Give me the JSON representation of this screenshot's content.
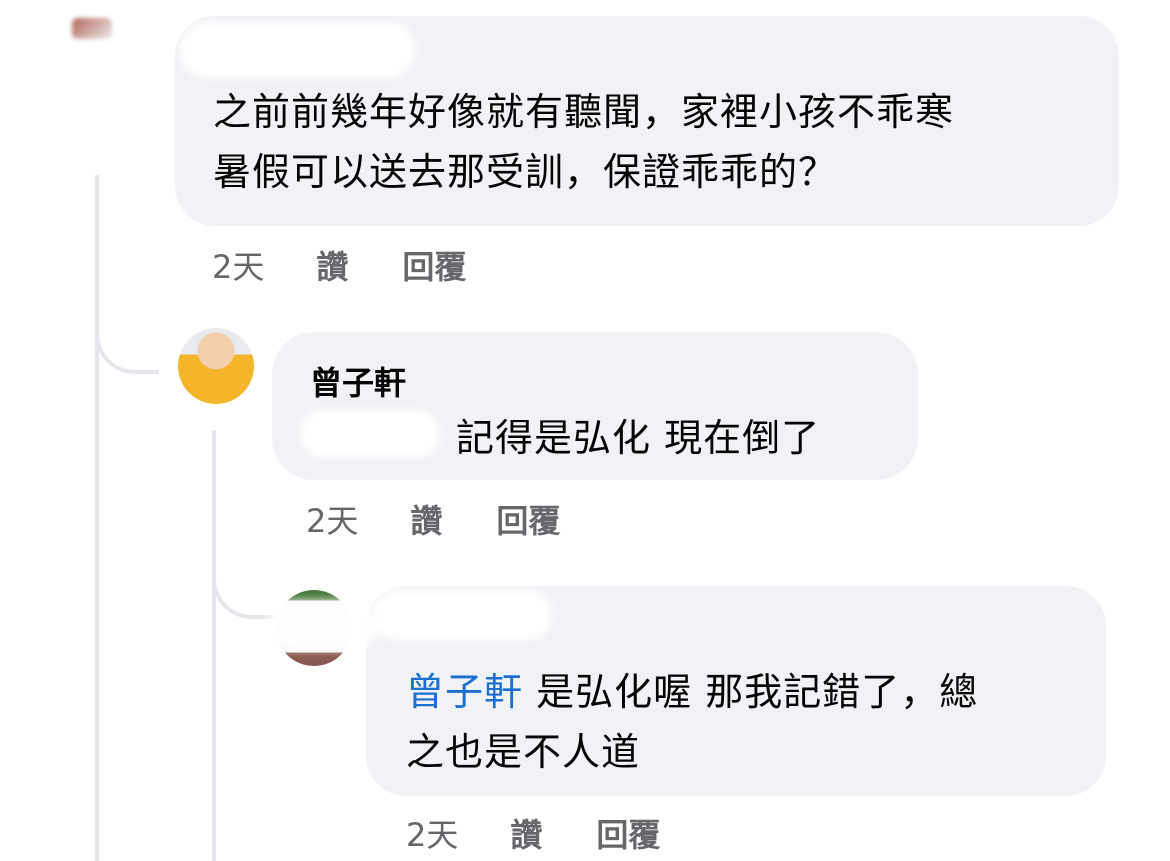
{
  "comments": [
    {
      "text": "之前前幾年好像就有聽聞，家裡小孩不乖寒暑假可以送去那受訓，保證乖乖的？",
      "line1": "之前前幾年好像就有聽聞，家裡小孩不乖寒",
      "line2": "暑假可以送去那受訓，保證乖乖的？",
      "time": "2天",
      "like_label": "讚",
      "reply_label": "回覆"
    },
    {
      "author": "曾子軒",
      "text": "記得是弘化 現在倒了",
      "time": "2天",
      "like_label": "讚",
      "reply_label": "回覆"
    },
    {
      "mention": "曾子軒",
      "line1_rest": "是弘化喔 那我記錯了，總",
      "line2": "之也是不人道",
      "time": "2天",
      "like_label": "讚",
      "reply_label": "回覆"
    }
  ],
  "colors": {
    "bubble": "#f0f2f5",
    "mention": "#1b6fd1",
    "meta": "#65676b",
    "thread_line": "#e4e6eb"
  }
}
